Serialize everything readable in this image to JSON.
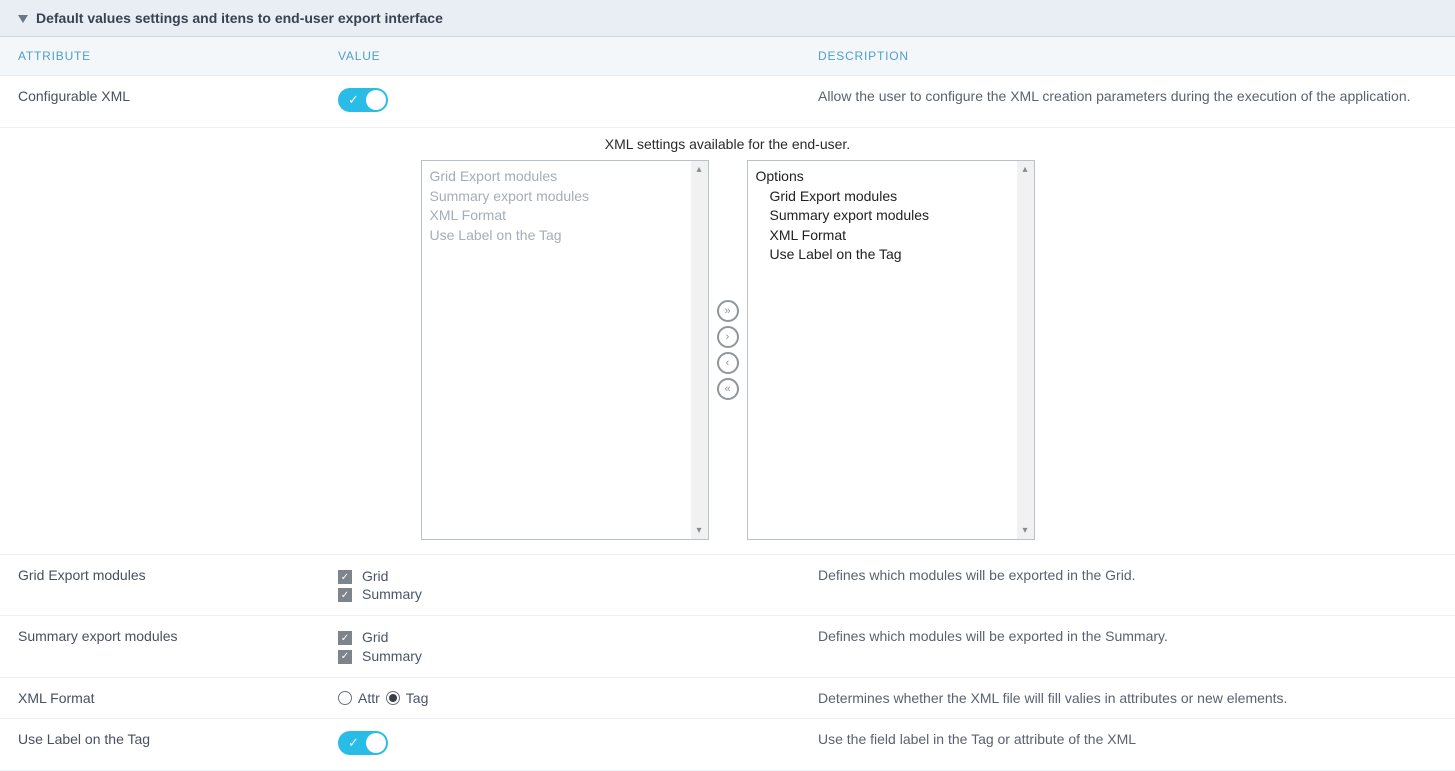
{
  "panel": {
    "title": "Default values settings and itens to end-user export interface"
  },
  "columns": {
    "attribute": "ATTRIBUTE",
    "value": "VALUE",
    "description": "DESCRIPTION"
  },
  "rows": {
    "configurable_xml": {
      "label": "Configurable XML",
      "toggle_on": true,
      "desc": "Allow the user to configure the XML creation parameters during the execution of the application."
    },
    "xml_settings": {
      "caption": "XML settings available for the end-user.",
      "left_list": [
        "Grid Export modules",
        "Summary export modules",
        "XML Format",
        "Use Label on the Tag"
      ],
      "right_list_header": "Options",
      "right_list": [
        "Grid Export modules",
        "Summary export modules",
        "XML Format",
        "Use Label on the Tag"
      ]
    },
    "grid_export": {
      "label": "Grid Export modules",
      "options": {
        "grid": "Grid",
        "summary": "Summary"
      },
      "desc": "Defines which modules will be exported in the Grid."
    },
    "summary_export": {
      "label": "Summary export modules",
      "options": {
        "grid": "Grid",
        "summary": "Summary"
      },
      "desc": "Defines which modules will be exported in the Summary."
    },
    "xml_format": {
      "label": "XML Format",
      "options": {
        "attr": "Attr",
        "tag": "Tag"
      },
      "desc": "Determines whether the XML file will fill valies in attributes or new elements."
    },
    "use_label": {
      "label": "Use Label on the Tag",
      "toggle_on": true,
      "desc": "Use the field label in the Tag or attribute of the XML"
    }
  },
  "glyphs": {
    "check": "✓",
    "double_right": "»",
    "single_right": "›",
    "single_left": "‹",
    "double_left": "«",
    "tri_up": "▴",
    "tri_down": "▾"
  }
}
